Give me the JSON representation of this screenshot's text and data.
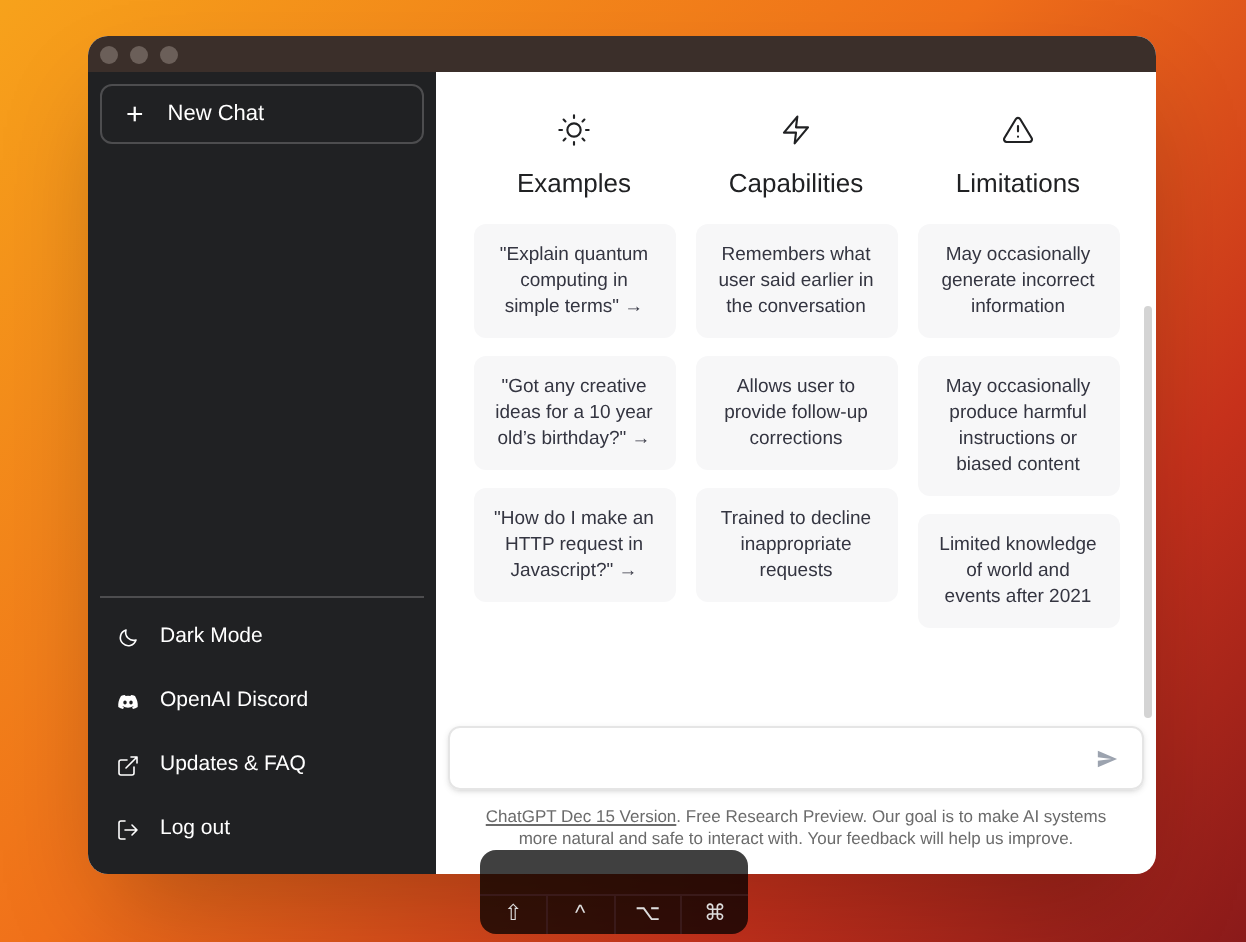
{
  "sidebar": {
    "new_chat": {
      "icon": "+",
      "label": "New Chat"
    },
    "items": [
      {
        "kind": "moon",
        "label": "Dark Mode"
      },
      {
        "kind": "discord",
        "label": "OpenAI Discord"
      },
      {
        "kind": "external",
        "label": "Updates & FAQ"
      },
      {
        "kind": "logout",
        "label": "Log out"
      }
    ]
  },
  "columns": [
    {
      "kind": "sun",
      "title": "Examples",
      "cards": [
        "\"Explain quantum computing in simple terms\" →",
        "\"Got any creative ideas for a 10 year old’s birthday?\" →",
        "\"How do I make an HTTP request in Javascript?\" →"
      ]
    },
    {
      "kind": "bolt",
      "title": "Capabilities",
      "cards": [
        "Remembers what user said earlier in the conversation",
        "Allows user to provide follow-up corrections",
        "Trained to decline inappropriate requests"
      ]
    },
    {
      "kind": "warning",
      "title": "Limitations",
      "cards": [
        "May occasionally generate incorrect information",
        "May occasionally produce harmful instructions or biased content",
        "Limited knowledge of world and events after 2021"
      ]
    }
  ],
  "footer": {
    "link": "ChatGPT Dec 15 Version",
    "text": ". Free Research Preview. Our goal is to make AI systems more natural and safe to interact with. Your feedback will help us improve."
  },
  "keys": [
    "⇧",
    "^",
    "⌥",
    "⌘"
  ]
}
